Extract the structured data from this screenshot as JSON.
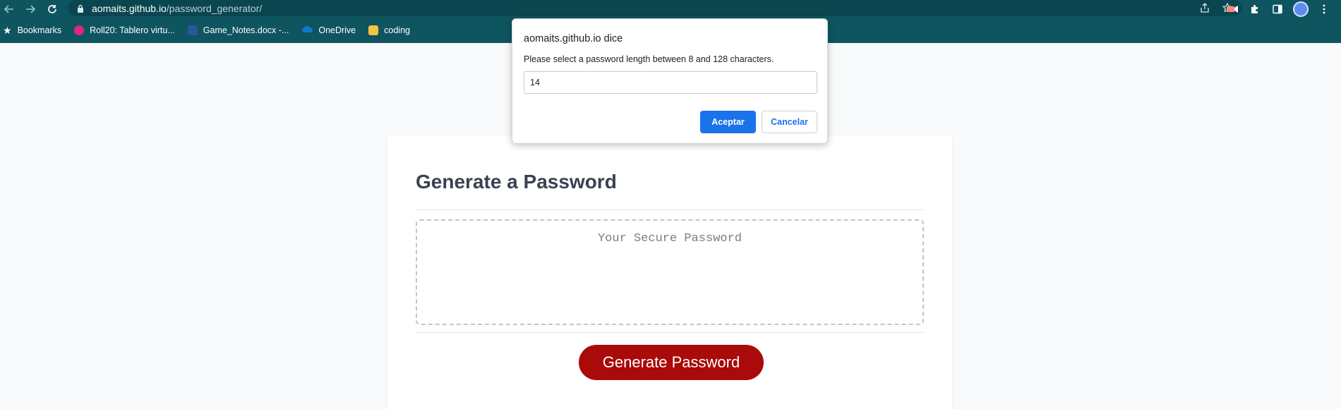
{
  "browser": {
    "url_host": "aomaits.github.io",
    "url_path": "/password_generator/",
    "bookmarks": [
      {
        "label": "Bookmarks",
        "icon": "star-icon"
      },
      {
        "label": "Roll20: Tablero virtu...",
        "icon": "roll20-icon",
        "color": "#e0267d"
      },
      {
        "label": "Game_Notes.docx -...",
        "icon": "word-icon",
        "color": "#2b579a"
      },
      {
        "label": "OneDrive",
        "icon": "onedrive-icon",
        "color": "#0f78d4"
      },
      {
        "label": "coding",
        "icon": "folder-icon",
        "color": "#f5c542"
      }
    ]
  },
  "page": {
    "title": "Generate a Password",
    "password_placeholder": "Your Secure Password",
    "generate_button": "Generate Password",
    "accent_color": "#a90a0a"
  },
  "dialog": {
    "title": "aomaits.github.io dice",
    "message": "Please select a password length between 8 and 128 characters.",
    "input_value": "14",
    "ok_label": "Aceptar",
    "cancel_label": "Cancelar",
    "accent_color": "#1a73e8"
  }
}
